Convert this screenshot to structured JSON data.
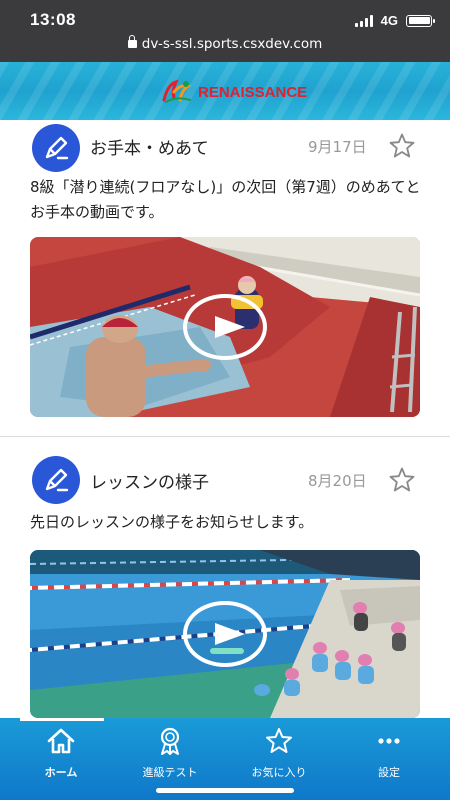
{
  "status_bar": {
    "time": "13:08",
    "network": "4G",
    "url": "dv-s-ssl.sports.csxdev.com"
  },
  "header": {
    "logo_text": "RENAISSANCE"
  },
  "posts": [
    {
      "icon": "pencil-icon",
      "title": "お手本・めあて",
      "date": "9月17日",
      "body": "8級「潜り連続(フロアなし)」の次回（第7週）のめあてとお手本の動画です。",
      "favorite_icon": "star-outline-icon",
      "video": "pool-lesson-video-1"
    },
    {
      "icon": "pencil-icon",
      "title": "レッスンの様子",
      "date": "8月20日",
      "body": "先日のレッスンの様子をお知らせします。",
      "favorite_icon": "star-outline-icon",
      "video": "pool-lesson-video-2"
    }
  ],
  "tab_bar": {
    "tabs": [
      {
        "label": "ホーム",
        "icon": "home-icon",
        "active": true
      },
      {
        "label": "進級テスト",
        "icon": "award-icon",
        "active": false
      },
      {
        "label": "お気に入り",
        "icon": "star-icon",
        "active": false
      },
      {
        "label": "設定",
        "icon": "more-icon",
        "active": false
      }
    ]
  },
  "colors": {
    "status_bar_bg": "#3b3b3d",
    "header_bg": "#1fa2cf",
    "logo_red": "#e2202f",
    "post_icon_bg": "#2a56d8",
    "tab_bar_bg": "#0f78c9",
    "date_text": "#999999"
  }
}
